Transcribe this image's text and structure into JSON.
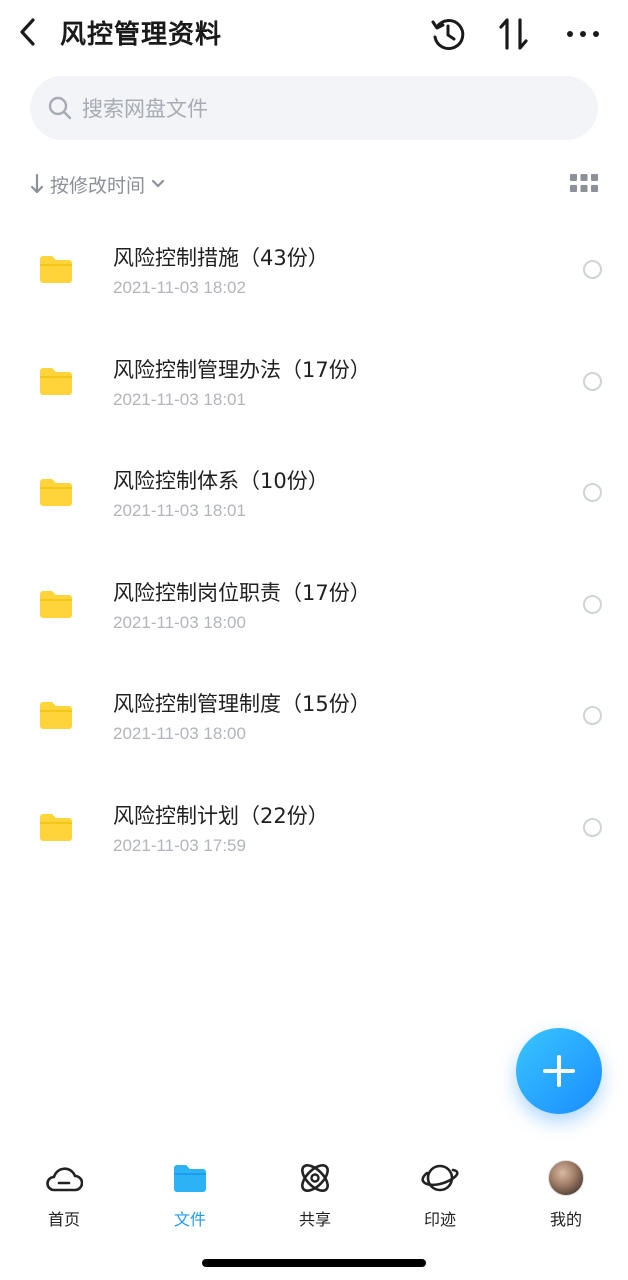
{
  "header": {
    "title": "风控管理资料",
    "icons": [
      "back-icon",
      "history-icon",
      "sort-icon",
      "more-icon"
    ]
  },
  "search": {
    "placeholder": "搜索网盘文件"
  },
  "sort": {
    "label": "按修改时间"
  },
  "files": [
    {
      "name": "风险控制措施（43份）",
      "date": "2021-11-03 18:02"
    },
    {
      "name": "风险控制管理办法（17份）",
      "date": "2021-11-03 18:01"
    },
    {
      "name": "风险控制体系（10份）",
      "date": "2021-11-03 18:01"
    },
    {
      "name": "风险控制岗位职责（17份）",
      "date": "2021-11-03 18:00"
    },
    {
      "name": "风险控制管理制度（15份）",
      "date": "2021-11-03 18:00"
    },
    {
      "name": "风险控制计划（22份）",
      "date": "2021-11-03 17:59"
    }
  ],
  "tabs": [
    {
      "label": "首页",
      "icon": "cloud-icon"
    },
    {
      "label": "文件",
      "icon": "folder-icon",
      "active": true
    },
    {
      "label": "共享",
      "icon": "orbit-icon"
    },
    {
      "label": "印迹",
      "icon": "planet-icon"
    },
    {
      "label": "我的",
      "icon": "avatar"
    }
  ],
  "colors": {
    "accent": "#1e9cf0",
    "folder": "#ffd43b",
    "fab": "#1a8cff"
  }
}
